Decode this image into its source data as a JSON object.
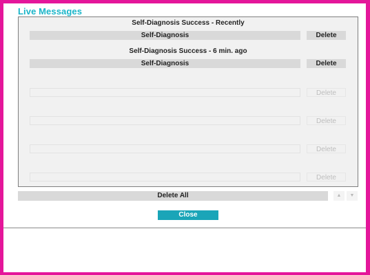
{
  "dialog": {
    "title": "Live Messages",
    "accent_color": "#1ab5c9",
    "frame_color": "#e4169a"
  },
  "messages": [
    {
      "text": "Self-Diagnosis Success - Recently",
      "action_label": "Self-Diagnosis",
      "delete_label": "Delete"
    },
    {
      "text": "Self-Diagnosis Success - 6 min. ago",
      "action_label": "Self-Diagnosis",
      "delete_label": "Delete"
    },
    {
      "text": "",
      "action_label": "",
      "delete_label": "Delete"
    },
    {
      "text": "",
      "action_label": "",
      "delete_label": "Delete"
    },
    {
      "text": "",
      "action_label": "",
      "delete_label": "Delete"
    },
    {
      "text": "",
      "action_label": "",
      "delete_label": "Delete"
    }
  ],
  "footer": {
    "delete_all_label": "Delete All",
    "scroll_up_icon": "chevron-up-icon",
    "scroll_down_icon": "chevron-down-icon",
    "close_label": "Close"
  }
}
